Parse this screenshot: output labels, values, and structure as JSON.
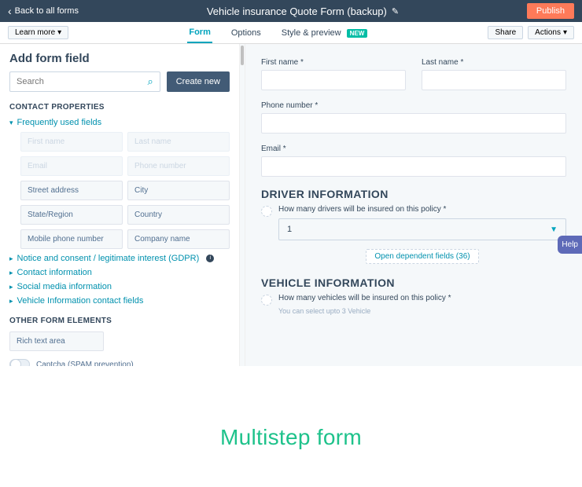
{
  "topbar": {
    "back": "Back to all forms",
    "title": "Vehicle insurance Quote Form (backup)",
    "publish": "Publish"
  },
  "subbar": {
    "learn_more": "Learn more",
    "tabs": {
      "form": "Form",
      "options": "Options",
      "style": "Style & preview",
      "new_badge": "NEW"
    },
    "share": "Share",
    "actions": "Actions"
  },
  "left": {
    "title": "Add form field",
    "search_placeholder": "Search",
    "create_new": "Create new",
    "section_contact": "CONTACT PROPERTIES",
    "frequently_used": "Frequently used fields",
    "fields": {
      "first_name": "First name",
      "last_name": "Last name",
      "email": "Email",
      "phone_number": "Phone number",
      "street_address": "Street address",
      "city": "City",
      "state_region": "State/Region",
      "country": "Country",
      "mobile_phone": "Mobile phone number",
      "company_name": "Company name"
    },
    "expanders": {
      "gdpr": "Notice and consent / legitimate interest (GDPR)",
      "contact_info": "Contact information",
      "social": "Social media information",
      "vehicle": "Vehicle Information contact fields"
    },
    "section_other": "OTHER FORM ELEMENTS",
    "rich_text": "Rich text area",
    "captcha": "Captcha (SPAM prevention)"
  },
  "right": {
    "first_name": "First name *",
    "last_name": "Last name *",
    "phone": "Phone number *",
    "email": "Email *",
    "driver_header": "DRIVER INFORMATION",
    "driver_q": "How many drivers will be insured on this policy *",
    "driver_value": "1",
    "dep_link": "Open dependent fields (36)",
    "vehicle_header": "VEHICLE INFORMATION",
    "vehicle_q": "How many vehicles will be insured on this policy *",
    "vehicle_hint": "You can select upto 3 Vehicle"
  },
  "help": "Help",
  "caption": "Multistep form"
}
